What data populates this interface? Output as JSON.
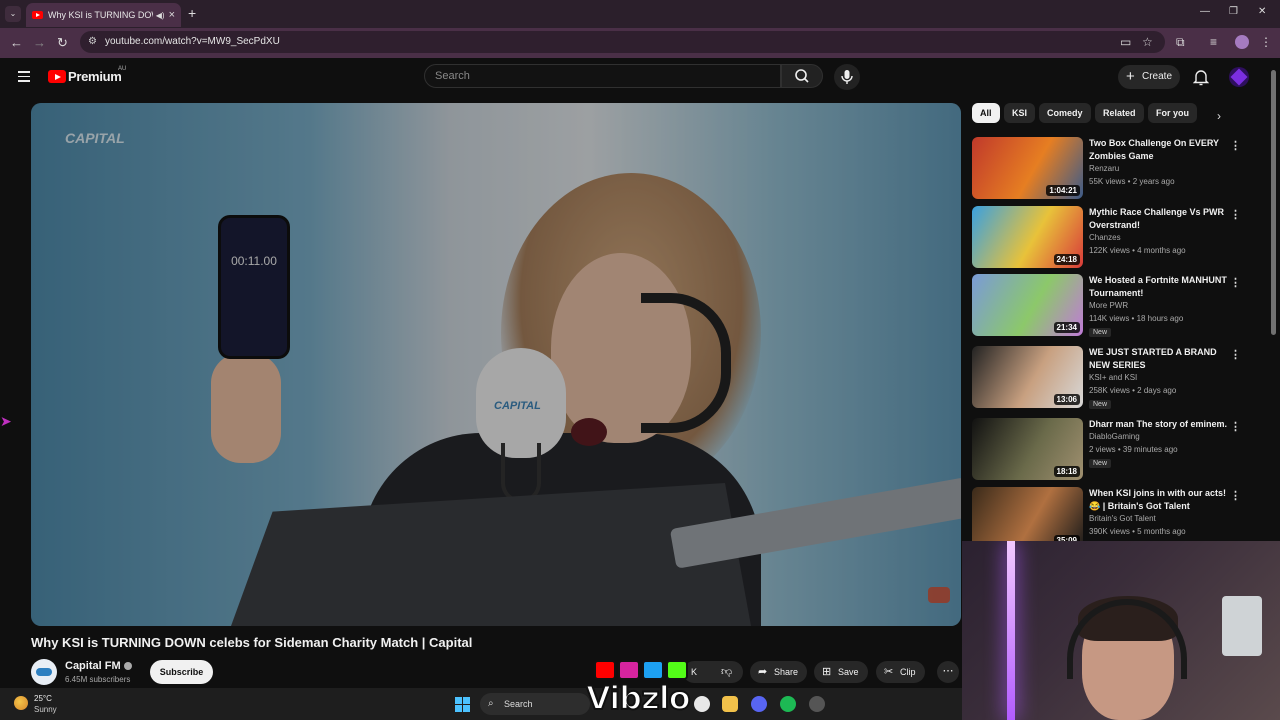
{
  "browser": {
    "tab_title": "Why KSI is TURNING DOWN",
    "url": "youtube.com/watch?v=MW9_SecPdXU"
  },
  "header": {
    "logo_text": "Premium",
    "region": "AU",
    "search_placeholder": "Search",
    "create_label": "Create"
  },
  "player": {
    "channel_overlay": "CAPITAL",
    "phone_timer": "00:11.00",
    "mic_label": "CAPITAL"
  },
  "video": {
    "title": "Why KSI is TURNING DOWN celebs for Sideman Charity Match | Capital",
    "channel": "Capital FM",
    "subscribers": "6.45M subscribers",
    "subscribe_label": "Subscribe",
    "like_count": "K",
    "share_label": "Share",
    "save_label": "Save",
    "clip_label": "Clip"
  },
  "chips": [
    "All",
    "KSI",
    "Comedy",
    "Related",
    "For you"
  ],
  "recommendations": [
    {
      "title": "Two Box Challenge On EVERY Zombies Game",
      "channel": "Renzaru",
      "meta": "55K views • 2 years ago",
      "duration": "1:04:21",
      "is_new": false,
      "colors": [
        "#c0392b",
        "#e67e22",
        "#3b5b8a"
      ]
    },
    {
      "title": "Mythic Race Challenge Vs PWR Overstrand!",
      "channel": "Chanzes",
      "meta": "122K views • 4 months ago",
      "duration": "24:18",
      "is_new": false,
      "colors": [
        "#3aa0e0",
        "#e8c23a",
        "#d83a3a"
      ]
    },
    {
      "title": "We Hosted a Fortnite MANHUNT Tournament!",
      "channel": "More PWR",
      "meta": "114K views • 18 hours ago",
      "duration": "21:34",
      "is_new": true,
      "colors": [
        "#7a9ad8",
        "#8cc86a",
        "#c07ad8"
      ]
    },
    {
      "title": "WE JUST STARTED A BRAND NEW SERIES",
      "channel": "KSI+ and KSI",
      "meta": "258K views • 2 days ago",
      "duration": "13:06",
      "is_new": true,
      "colors": [
        "#222222",
        "#c8a080",
        "#d8d8d8"
      ]
    },
    {
      "title": "Dharr man The story of eminem.",
      "channel": "DiabloGaming",
      "meta": "2 views • 39 minutes ago",
      "duration": "18:18",
      "is_new": true,
      "colors": [
        "#111111",
        "#6a6a4a",
        "#a09070"
      ]
    },
    {
      "title": "When KSI joins in with our acts! 😂 | Britain's Got Talent",
      "channel": "Britain's Got Talent",
      "meta": "390K views • 5 months ago",
      "duration": "35:09",
      "is_new": false,
      "colors": [
        "#3a2a1a",
        "#b07040",
        "#1a1a1a"
      ]
    }
  ],
  "overlay": {
    "brand": "Vibzlo"
  },
  "taskbar": {
    "temperature": "25°C",
    "condition": "Sunny",
    "search_label": "Search"
  }
}
